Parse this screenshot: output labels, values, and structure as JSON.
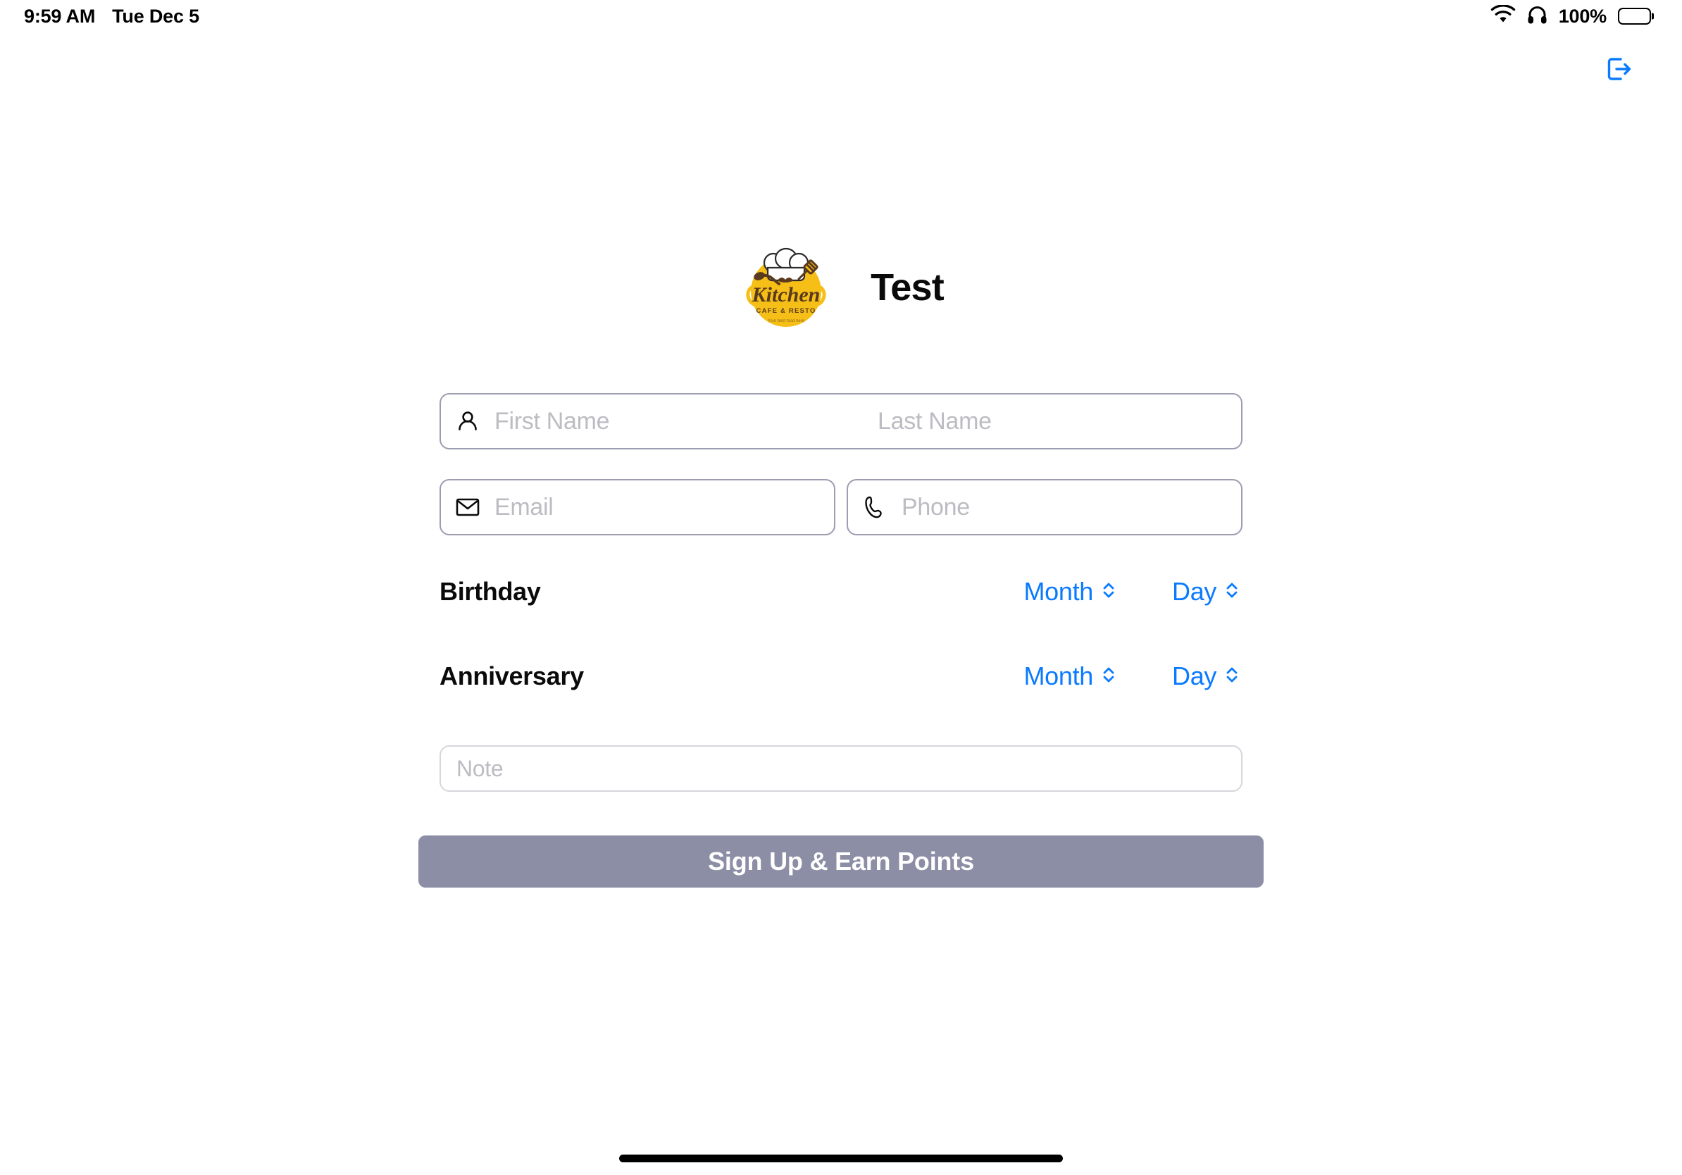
{
  "status_bar": {
    "time": "9:59 AM",
    "date": "Tue Dec 5",
    "battery_percent": "100%",
    "icons": [
      "wifi-icon",
      "headphones-icon",
      "battery-icon"
    ]
  },
  "header": {
    "logout_icon": "logout-icon",
    "brand_title": "Test",
    "logo": {
      "name": "kitchen-cafe-resto-logo",
      "wordmark": "Kitchen",
      "tagline": "CAFE & RESTO",
      "background": "#f5bf18"
    }
  },
  "form": {
    "name_field": {
      "icon": "person-icon",
      "first_name_placeholder": "First Name",
      "first_name_value": "",
      "last_name_placeholder": "Last Name",
      "last_name_value": ""
    },
    "email_field": {
      "icon": "envelope-icon",
      "placeholder": "Email",
      "value": ""
    },
    "phone_field": {
      "icon": "phone-icon",
      "placeholder": "Phone",
      "value": ""
    },
    "birthday": {
      "label": "Birthday",
      "month_value": "Month",
      "day_value": "Day",
      "chevron_icon": "chevron-up-down-icon"
    },
    "anniversary": {
      "label": "Anniversary",
      "month_value": "Month",
      "day_value": "Day",
      "chevron_icon": "chevron-up-down-icon"
    },
    "note_field": {
      "placeholder": "Note",
      "value": ""
    },
    "submit_button": {
      "label": "Sign Up & Earn Points",
      "enabled": false,
      "color": "#8b8ea5"
    }
  },
  "colors": {
    "accent_blue": "#0a7aff",
    "field_border": "#9d9db1",
    "note_border": "#d6d6dc",
    "placeholder": "#bcbcc2",
    "button_disabled": "#8b8ea5",
    "logo_yellow": "#f5bf18",
    "logo_brown": "#5a3a1e"
  }
}
